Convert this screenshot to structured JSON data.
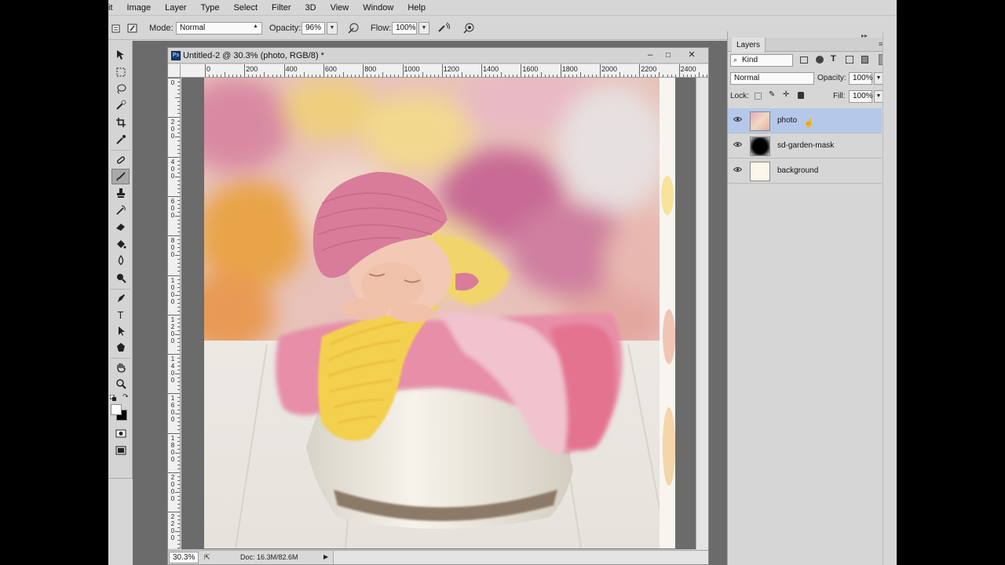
{
  "menubar": {
    "items": [
      "it",
      "Image",
      "Layer",
      "Type",
      "Select",
      "Filter",
      "3D",
      "View",
      "Window",
      "Help"
    ]
  },
  "options_bar": {
    "mode_label": "Mode:",
    "mode_value": "Normal",
    "opacity_label": "Opacity:",
    "opacity_value": "96%",
    "flow_label": "Flow:",
    "flow_value": "100%"
  },
  "document": {
    "title": "Untitled-2 @ 30.3% (photo, RGB/8) *",
    "ps_icon": "Ps",
    "minimize": "–",
    "maximize": "□",
    "close": "✕",
    "ruler_h": [
      "0",
      "200",
      "400",
      "600",
      "800",
      "1000",
      "1200",
      "1400",
      "1600",
      "1800",
      "2000",
      "2200",
      "2400"
    ],
    "ruler_v": [
      "0",
      "2 0 0",
      "4 0 0",
      "6 0 0",
      "8 0 0",
      "1 0 0 0",
      "1 2 0 0",
      "1 4 0 0",
      "1 6 0 0",
      "1 8 0 0",
      "2 0 0 0",
      "2 2 0 0"
    ],
    "zoom": "30.3%",
    "doc_info": "Doc: 16.3M/82.6M"
  },
  "layers_panel": {
    "tab_label": "Layers",
    "filter_kind": "Kind",
    "blend_mode": "Normal",
    "opacity_label": "Opacity:",
    "opacity_value": "100%",
    "lock_label": "Lock:",
    "fill_label": "Fill:",
    "fill_value": "100%",
    "layers": [
      {
        "name": "photo",
        "selected": true
      },
      {
        "name": "sd-garden-mask",
        "selected": false
      },
      {
        "name": "background",
        "selected": false
      }
    ]
  },
  "colors": {
    "selection": "#b5c8ea",
    "workspace": "#6b6b6b",
    "panel": "#d6d6d6"
  },
  "icons": [
    "brush-preset-icon",
    "toggle-brush-panel-icon",
    "airbrush-icon",
    "pressure-opacity-icon",
    "pressure-size-icon",
    "move-tool-icon",
    "marquee-tool-icon",
    "lasso-tool-icon",
    "quick-selection-icon",
    "crop-tool-icon",
    "eyedropper-icon",
    "healing-brush-icon",
    "brush-tool-icon",
    "clone-stamp-icon",
    "history-brush-icon",
    "eraser-icon",
    "paint-bucket-icon",
    "blur-tool-icon",
    "dodge-tool-icon",
    "pen-tool-icon",
    "type-tool-icon",
    "path-selection-icon",
    "shape-tool-icon",
    "hand-tool-icon",
    "zoom-tool-icon",
    "eye-icon",
    "lock-icon"
  ]
}
